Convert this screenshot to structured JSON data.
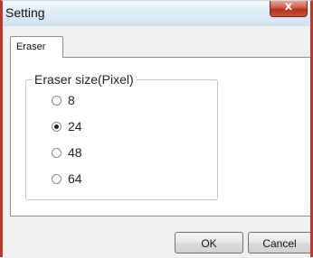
{
  "window": {
    "title": "Setting",
    "close_glyph": "x"
  },
  "tabs": [
    {
      "label": "Eraser",
      "active": true
    }
  ],
  "eraser_group": {
    "label": "Eraser size(Pixel)",
    "options": [
      {
        "label": "8",
        "selected": false
      },
      {
        "label": "24",
        "selected": true
      },
      {
        "label": "48",
        "selected": false
      },
      {
        "label": "64",
        "selected": false
      }
    ]
  },
  "buttons": {
    "ok": "OK",
    "cancel": "Cancel"
  },
  "colors": {
    "frame_accent": "#b73a2f",
    "close_button": "#c9503a",
    "title_bar": "#dce9f4"
  }
}
